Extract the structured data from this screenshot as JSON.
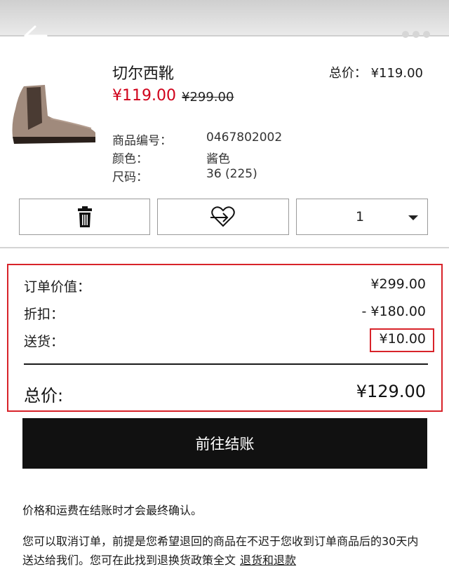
{
  "nav": {
    "back_icon": "back-arrow-icon",
    "more_icon": "more-dots-icon"
  },
  "product": {
    "name": "切尔西靴",
    "price": "¥119.00",
    "original_price": "¥299.00",
    "total_label": "总价： ¥119.00",
    "meta": [
      {
        "label": "商品编号：",
        "value": "0467802002"
      },
      {
        "label": "颜色：",
        "value": "酱色"
      },
      {
        "label": "尺码：",
        "value": "36 (225)"
      }
    ],
    "quantity": "1"
  },
  "summary": {
    "order_value_label": "订单价值：",
    "order_value": "¥299.00",
    "discount_label": "折扣：",
    "discount": "- ¥180.00",
    "shipping_label": "送货：",
    "shipping": "¥10.00",
    "total_label": "总价:",
    "total": "¥129.00"
  },
  "checkout_label": "前往结账",
  "notes": {
    "line1": "价格和运费在结账时才会最终确认。",
    "line2": "您可以取消订单，前提是您希望退回的商品在不迟于您收到订单商品后的30天内送达给我们。您可在此找到退换货政策全文",
    "link": "退货和退款"
  },
  "colors": {
    "accent_red": "#d0021b",
    "highlight_border": "#d8232a",
    "button_bg": "#111111"
  }
}
